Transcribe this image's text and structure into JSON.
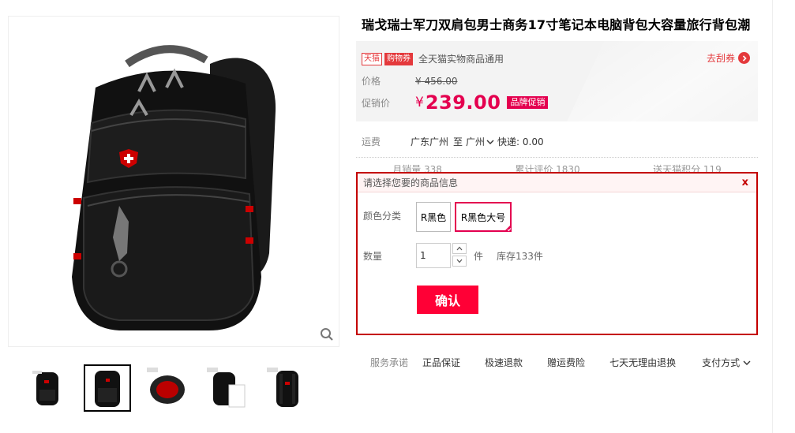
{
  "product": {
    "title": "瑞戈瑞士军刀双肩包男士商务17寸笔记本电脑背包大容量旅行背包潮"
  },
  "coupon": {
    "tag_tmall": "天猫",
    "tag_coupon": "购物券",
    "text": "全天猫实物商品通用",
    "link": "去刮券"
  },
  "price": {
    "label": "价格",
    "currency": "¥",
    "original": "456.00",
    "promo_label": "促销价",
    "promo": "239.00",
    "badge": "品牌促销"
  },
  "shipping": {
    "label": "运费",
    "from": "广东广州",
    "to_word": "至",
    "to": "广州",
    "fee": "快递: 0.00"
  },
  "stats": [
    "月销量 338",
    "累计评价 1830",
    "送天猫积分 119"
  ],
  "popup": {
    "title": "请选择您要的商品信息",
    "close": "x",
    "color_label": "颜色分类",
    "options": [
      "R黑色",
      "R黑色大号"
    ],
    "selected_option": "R黑色大号",
    "qty_label": "数量",
    "qty_value": "1",
    "unit": "件",
    "stock": "库存133件",
    "confirm": "确认"
  },
  "services": {
    "label": "服务承诺",
    "items": [
      "正品保证",
      "极速退款",
      "赠运费险",
      "七天无理由退换"
    ],
    "payment": "支付方式"
  },
  "colors": {
    "accent": "#e4004f",
    "popup_border": "#c40000",
    "confirm_bg": "#ff0036"
  }
}
